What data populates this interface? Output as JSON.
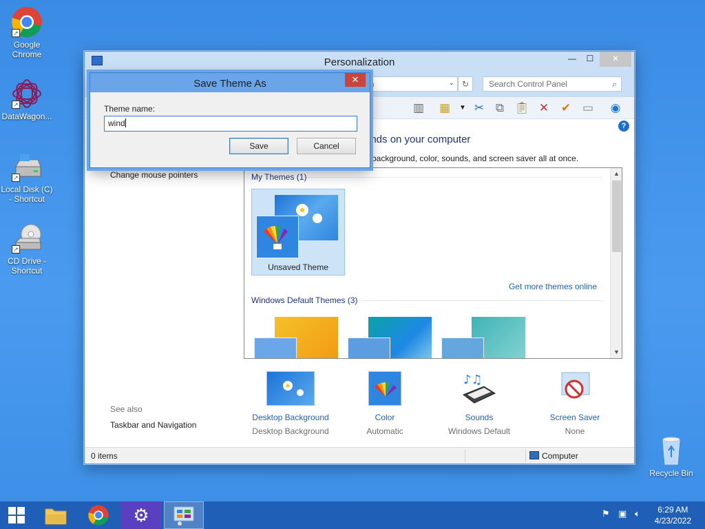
{
  "desktop": {
    "icons": [
      {
        "label": "Google Chrome"
      },
      {
        "label": "DataWagon..."
      },
      {
        "label": "Local Disk (C) - Shortcut"
      },
      {
        "label": "CD Drive - Shortcut"
      },
      {
        "label": "Recycle Bin"
      }
    ]
  },
  "window": {
    "title": "Personalization",
    "address_text": "on",
    "search_placeholder": "Search Control Panel",
    "heading": "unds on your computer",
    "subheading": "p background, color, sounds, and screen saver all at once.",
    "sidebar": {
      "change_mouse_pointers": "Change mouse pointers",
      "see_also": "See also",
      "taskbar_navigation": "Taskbar and Navigation"
    },
    "themes": {
      "my_themes_title": "My Themes (1)",
      "unsaved_theme": "Unsaved Theme",
      "get_more": "Get more themes online",
      "default_title": "Windows Default Themes (3)"
    },
    "settings": [
      {
        "label": "Desktop Background",
        "value": "Desktop Background",
        "icon": "desktop-background-icon"
      },
      {
        "label": "Color",
        "value": "Automatic",
        "icon": "color-icon"
      },
      {
        "label": "Sounds",
        "value": "Windows Default",
        "icon": "sounds-icon"
      },
      {
        "label": "Screen Saver",
        "value": "None",
        "icon": "screen-saver-icon"
      }
    ],
    "status": {
      "items": "0 items",
      "location": "Computer"
    }
  },
  "dialog": {
    "title": "Save Theme As",
    "label": "Theme name:",
    "input_value": "wind",
    "save": "Save",
    "cancel": "Cancel"
  },
  "taskbar": {
    "time": "6:29 AM",
    "date": "4/23/2022"
  },
  "colors": {
    "desktop": "#3a8be4",
    "title_bar": "#c9dff5",
    "link": "#1f62bf",
    "heading": "#1e3287",
    "dialog_frame": "#6aa5ea",
    "close_button": "#c7453a",
    "taskbar": "#1f5fb8"
  }
}
